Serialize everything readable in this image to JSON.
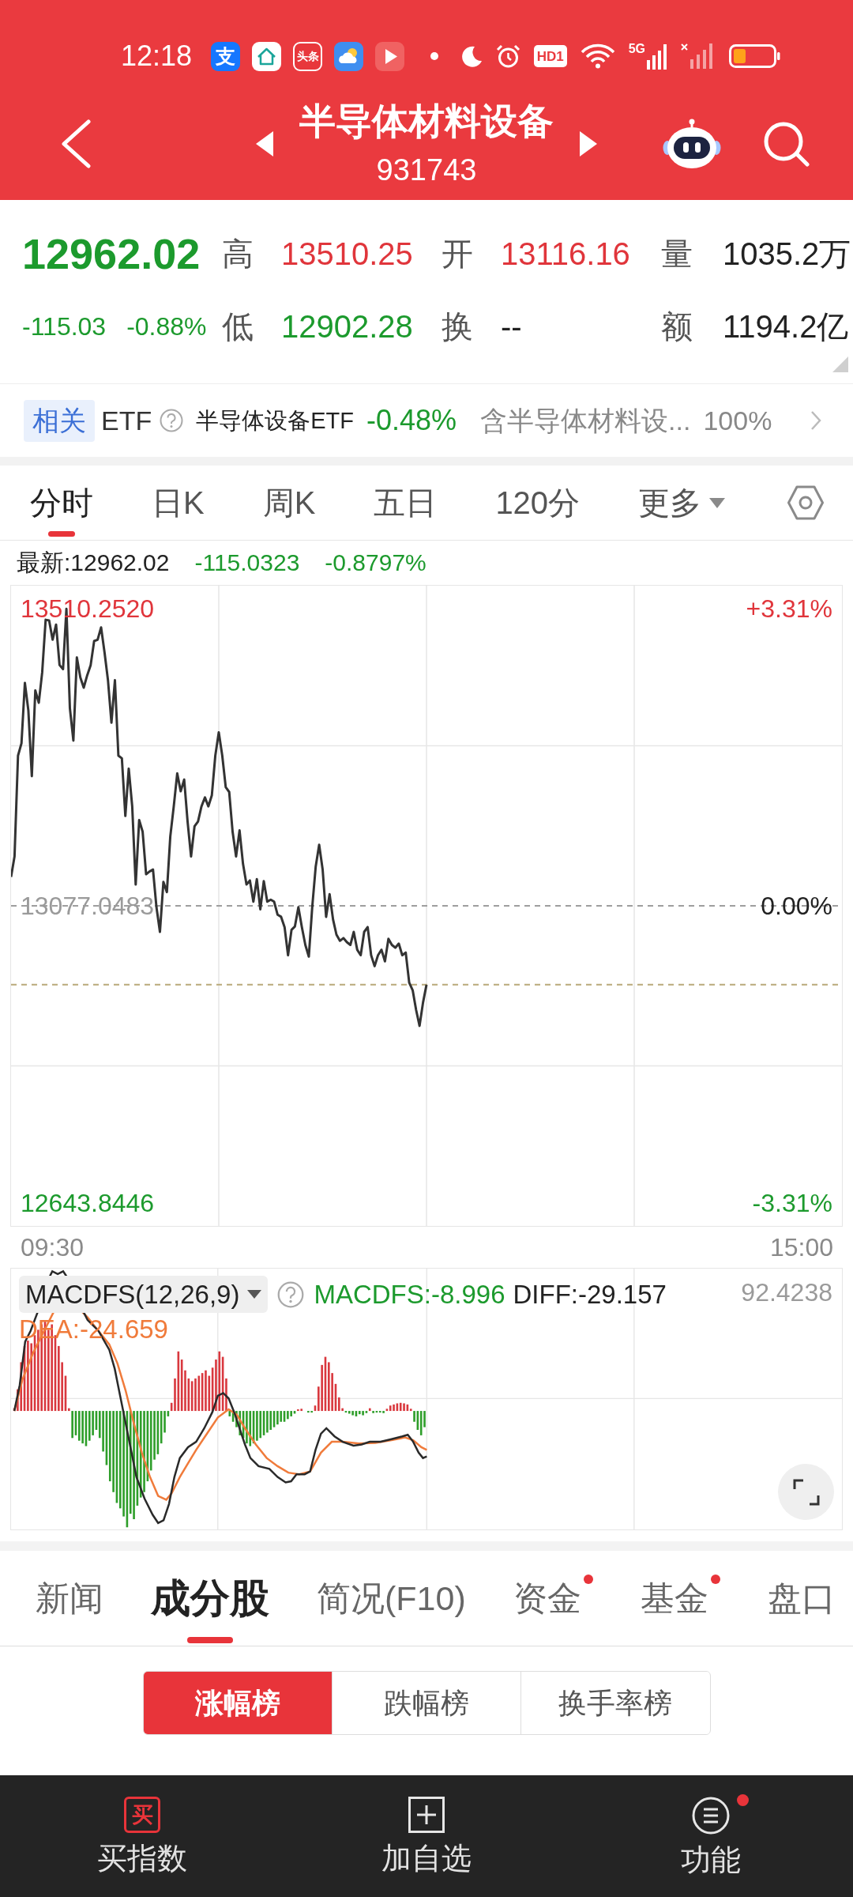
{
  "status_bar": {
    "time": "12:18",
    "notifications": [
      {
        "kind": "pay",
        "glyph": "支"
      },
      {
        "kind": "home"
      },
      {
        "kind": "news",
        "glyph": "头条"
      },
      {
        "kind": "weather"
      },
      {
        "kind": "video"
      },
      {
        "kind": "more"
      }
    ],
    "hd_badge": "HD1",
    "network": "5G"
  },
  "header": {
    "title": "半导体材料设备",
    "code": "931743"
  },
  "quote": {
    "price": "12962.02",
    "change": "-115.03",
    "change_pct": "-0.88%",
    "color": "#1c9a2d",
    "stat_rows": [
      [
        {
          "label": "高",
          "value": "13510.25",
          "color": "#e0353b"
        },
        {
          "label": "开",
          "value": "13116.16",
          "color": "#e0353b"
        },
        {
          "label": "量",
          "value": "1035.2万",
          "color": "#222222"
        }
      ],
      [
        {
          "label": "低",
          "value": "12902.28",
          "color": "#1c9a2d"
        },
        {
          "label": "换",
          "value": "--",
          "color": "#222222"
        },
        {
          "label": "额",
          "value": "1194.2亿",
          "color": "#222222"
        }
      ]
    ]
  },
  "related": {
    "badge": "相关",
    "category": "ETF",
    "name": "半导体设备ETF",
    "change": "-0.48%",
    "color": "#1c9a2d",
    "holding": "含半导体材料设...",
    "holding_pct": "100%"
  },
  "chart_tabs": [
    {
      "label": "分时",
      "kind": "tab",
      "selected": true
    },
    {
      "label": "日K",
      "kind": "tab",
      "selected": false
    },
    {
      "label": "周K",
      "kind": "tab",
      "selected": false
    },
    {
      "label": "五日",
      "kind": "tab",
      "selected": false
    },
    {
      "label": "120分",
      "kind": "tab",
      "selected": false
    },
    {
      "label": "更多",
      "kind": "dropdown",
      "selected": false
    }
  ],
  "intraday": {
    "latest": "最新:12962.02",
    "latest_change": "-115.0323",
    "latest_pct": "-0.8797%",
    "color": "#1c9a2d",
    "percent_labels": [
      {
        "label": "+3.31%",
        "color": "#e0353b"
      },
      {
        "label": "0.00%",
        "color": "#222222"
      },
      {
        "label": "-3.31%",
        "color": "#1c9a2d"
      }
    ],
    "chart_data": {
      "type": "line",
      "categories": [
        null,
        null,
        null,
        null,
        null,
        null,
        null,
        null,
        null,
        null,
        null,
        null,
        null,
        null,
        null,
        null,
        null,
        null,
        null,
        null,
        null,
        null,
        null,
        null,
        null,
        null,
        null,
        null,
        null,
        null,
        null,
        null,
        null,
        null,
        null,
        null,
        null,
        null,
        null,
        null,
        null,
        null,
        null,
        null,
        null,
        null,
        null,
        null,
        null,
        null,
        null,
        null,
        null,
        null,
        null,
        null,
        null,
        null,
        null,
        null,
        null,
        null,
        null,
        null,
        null,
        null,
        null,
        null,
        null,
        null,
        null,
        null,
        null,
        null,
        null,
        null,
        null,
        null,
        null,
        null,
        null,
        null,
        null,
        null,
        null,
        null,
        null,
        null,
        null,
        null,
        null,
        null,
        null,
        null,
        null,
        null,
        null,
        null,
        null,
        null,
        null,
        null,
        null,
        null,
        null,
        null,
        null,
        null,
        null,
        null,
        null,
        null,
        null,
        null,
        null,
        null,
        null,
        null,
        null,
        null,
        null,
        null,
        null,
        null,
        null,
        null,
        null,
        null,
        null,
        null,
        null,
        null,
        null,
        null,
        null,
        null,
        null,
        null,
        null,
        null,
        null,
        null,
        null,
        null,
        null,
        null,
        null,
        null,
        null,
        null,
        null,
        null,
        null,
        null,
        null,
        null,
        null,
        null,
        null,
        null,
        null,
        null,
        null,
        null,
        null,
        null,
        null,
        null,
        null,
        null,
        null,
        null,
        null,
        null,
        null,
        null,
        null,
        null,
        null,
        null,
        null,
        null,
        null,
        null,
        null,
        null,
        null,
        null,
        null,
        null,
        null,
        null,
        null,
        null,
        null,
        null,
        null,
        null,
        null,
        null,
        null,
        null,
        null,
        null,
        null,
        null,
        null,
        null,
        null,
        null,
        null,
        null,
        null,
        null,
        null,
        null,
        null,
        null,
        null,
        null,
        null,
        null,
        null,
        null,
        null,
        null,
        null,
        null,
        null,
        null,
        null,
        null,
        null,
        null,
        null,
        null,
        null,
        null,
        null,
        null,
        null
      ],
      "ylim": [
        12610.43,
        13543.66
      ],
      "yticks": [
        {
          "value": 13510.252,
          "label": "13510.2520"
        },
        {
          "value": 13077.0483,
          "label": "13077.0483"
        },
        {
          "value": 12643.8446,
          "label": "12643.8446"
        }
      ],
      "series": [
        {
          "color": "#333333",
          "values": [
            13119,
            13149,
            13296,
            13314,
            13402,
            13362,
            13266,
            13391,
            13373,
            13417,
            13494,
            13493,
            13465,
            13487,
            13428,
            13422,
            13510,
            13365,
            13318,
            13439,
            13410,
            13395,
            13413,
            13428,
            13463,
            13465,
            13483,
            13446,
            13406,
            13344,
            13406,
            13296,
            13292,
            13208,
            13277,
            13222,
            13108,
            13202,
            13185,
            13123,
            13127,
            13130,
            13075,
            13039,
            13112,
            13097,
            13178,
            13222,
            13270,
            13244,
            13261,
            13200,
            13149,
            13193,
            13200,
            13222,
            13235,
            13222,
            13238,
            13296,
            13330,
            13296,
            13250,
            13243,
            13185,
            13149,
            13187,
            13138,
            13108,
            13114,
            13083,
            13116,
            13072,
            13113,
            13083,
            13086,
            13083,
            13064,
            13061,
            13046,
            13005,
            13042,
            13047,
            13075,
            13046,
            13020,
            13003,
            13075,
            13134,
            13166,
            13130,
            13061,
            13094,
            13057,
            13035,
            13026,
            13030,
            13024,
            13020,
            13039,
            13013,
            13005,
            13039,
            13046,
            13005,
            12989,
            13005,
            13013,
            12996,
            13029,
            13020,
            13016,
            13022,
            13005,
            13009,
            12965,
            12954,
            12925,
            12902,
            12936,
            12962,
            null,
            null,
            null,
            null,
            null,
            null,
            null,
            null,
            null,
            null,
            null,
            null,
            null,
            null,
            null,
            null,
            null,
            null,
            null,
            null,
            null,
            null,
            null,
            null,
            null,
            null,
            null,
            null,
            null,
            null,
            null,
            null,
            null,
            null,
            null,
            null,
            null,
            null,
            null,
            null,
            null,
            null,
            null,
            null,
            null,
            null,
            null,
            null,
            null,
            null,
            null,
            null,
            null,
            null,
            null,
            null,
            null,
            null,
            null,
            null,
            null,
            null,
            null,
            null,
            null,
            null,
            null,
            null,
            null,
            null,
            null,
            null,
            null,
            null,
            null,
            null,
            null,
            null,
            null,
            null,
            null,
            null,
            null,
            null,
            null,
            null,
            null,
            null,
            null,
            null,
            null,
            null,
            null,
            null,
            null,
            null,
            null,
            null,
            null,
            null,
            null,
            null,
            null,
            null,
            null,
            null,
            null,
            null,
            null,
            null,
            null,
            null,
            null,
            null,
            null,
            null,
            null,
            null,
            null,
            null
          ]
        }
      ],
      "ref_lines": [
        {
          "axis": "y",
          "value": 13077.0483
        },
        {
          "axis": "y",
          "value": 12962.02
        }
      ]
    },
    "time_labels": [
      "09:30",
      "15:00"
    ]
  },
  "macd": {
    "indicator": "MACDFS(12,26,9)",
    "macdfs": "MACDFS:-8.996",
    "diff": "DIFF:-29.157",
    "dea": "DEA:-24.659",
    "top_value": "92.4238"
  },
  "bottom_tabs": [
    {
      "label": "新闻",
      "selected": false,
      "dot": false
    },
    {
      "label": "成分股",
      "selected": true,
      "dot": false
    },
    {
      "label": "简况(F10)",
      "selected": false,
      "dot": false
    },
    {
      "label": "资金",
      "selected": false,
      "dot": true
    },
    {
      "label": "基金",
      "selected": false,
      "dot": true
    },
    {
      "label": "盘口",
      "selected": false,
      "dot": false
    }
  ],
  "rank_tabs": [
    {
      "label": "涨幅榜",
      "selected": true
    },
    {
      "label": "跌幅榜",
      "selected": false
    },
    {
      "label": "换手率榜",
      "selected": false
    }
  ],
  "bottom_nav": [
    {
      "kind": "buy",
      "glyph": "买",
      "label": "买指数",
      "dot": false
    },
    {
      "kind": "add",
      "label": "加自选",
      "dot": false
    },
    {
      "kind": "menu",
      "label": "功能",
      "dot": true
    }
  ]
}
